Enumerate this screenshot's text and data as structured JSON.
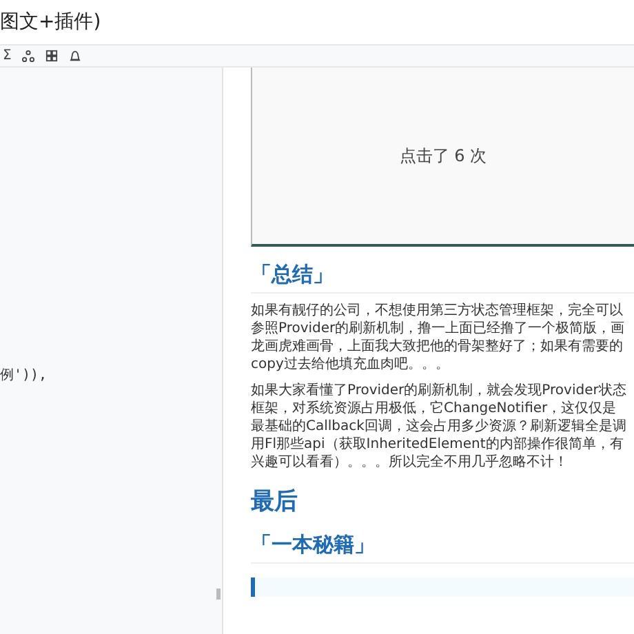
{
  "title": "图文+插件)",
  "toolbar": [
    {
      "kind": "sigma",
      "text": "Σ"
    },
    {
      "kind": "tree"
    },
    {
      "kind": "grid"
    },
    {
      "kind": "bell"
    }
  ],
  "editor": {
    "lines": [
      "例')),"
    ]
  },
  "preview": {
    "demo_text": "点击了 6 次",
    "blocks": [
      {
        "kind": "h3",
        "text": "「总结」"
      },
      {
        "kind": "p",
        "text": "如果有靓仔的公司，不想使用第三方状态管理框架，完全可以参照Provider的刷新机制，撸一上面已经撸了一个极简版，画龙画虎难画骨，上面我大致把他的骨架整好了；如果有需要的copy过去给他填充血肉吧。。。"
      },
      {
        "kind": "p",
        "text": "如果大家看懂了Provider的刷新机制，就会发现Provider状态框架，对系统资源占用极低，它ChangeNotifier，这仅仅是最基础的Callback回调，这会占用多少资源？刷新逻辑全是调用Fl那些api（获取InheritedElement的内部操作很简单，有兴趣可以看看）。。。所以完全不用几乎忽略不计！"
      },
      {
        "kind": "h2",
        "text": "最后"
      },
      {
        "kind": "h3",
        "text": "「一本秘籍」"
      },
      {
        "kind": "quote"
      }
    ]
  }
}
